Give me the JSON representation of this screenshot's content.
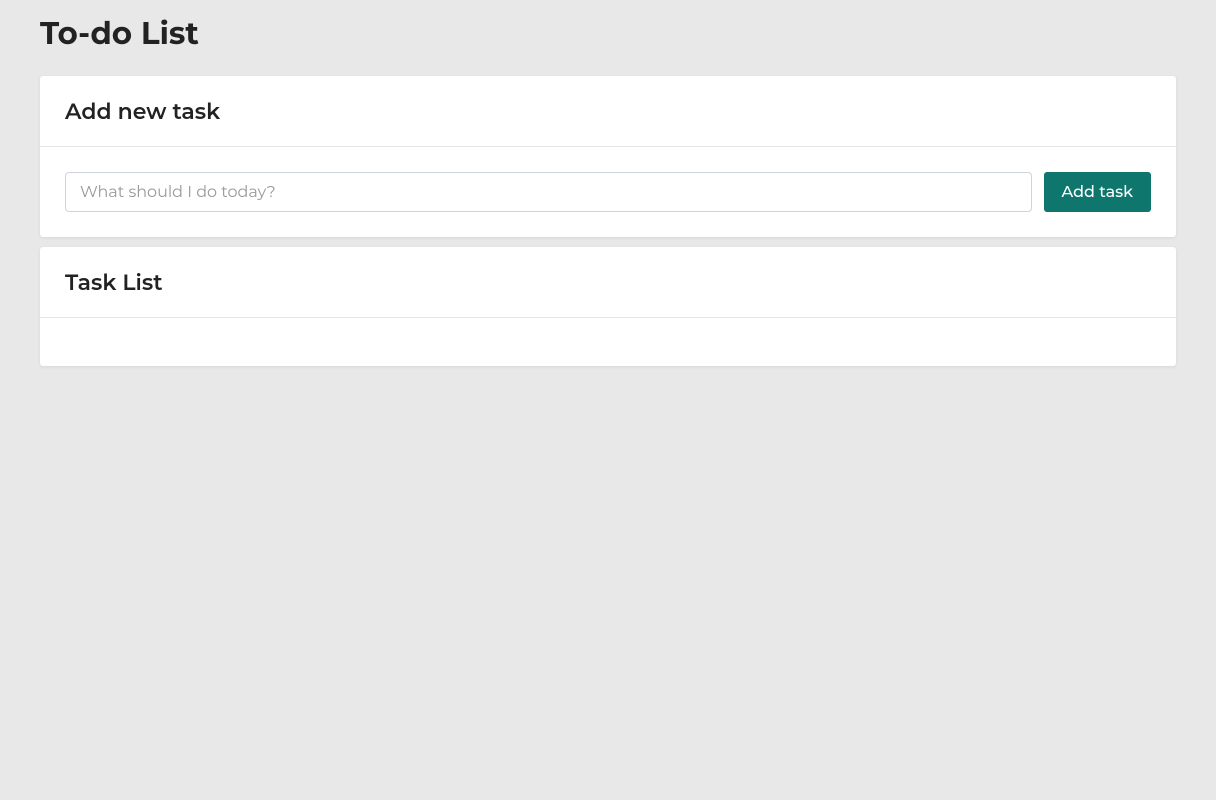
{
  "page": {
    "title": "To-do List"
  },
  "add_task_card": {
    "header": "Add new task",
    "input_placeholder": "What should I do today?",
    "input_value": "",
    "button_label": "Add task"
  },
  "task_list_card": {
    "header": "Task List",
    "tasks": []
  },
  "colors": {
    "accent": "#0f766e",
    "background": "#e8e8e8",
    "card": "#ffffff",
    "border": "#ced4da"
  }
}
